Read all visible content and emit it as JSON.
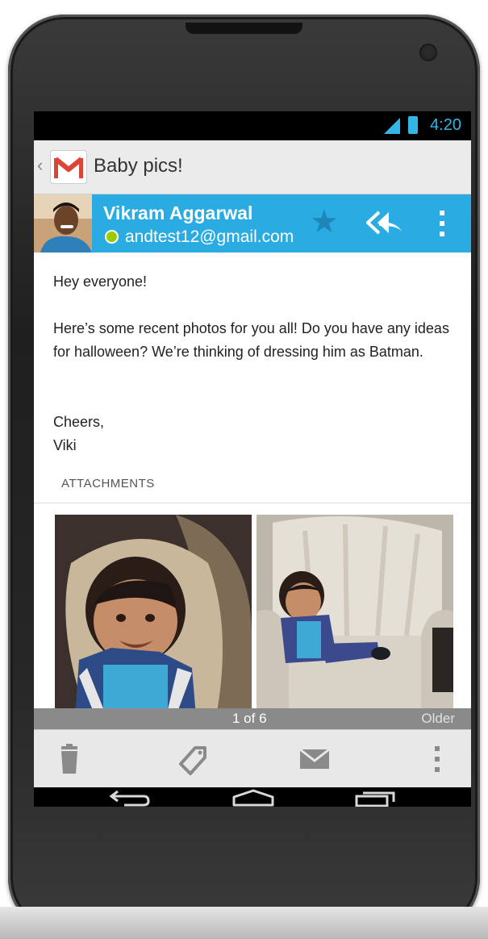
{
  "status": {
    "time": "4:20"
  },
  "actionbar": {
    "subject": "Baby pics!"
  },
  "sender": {
    "name": "Vikram Aggarwal",
    "email": "andtest12@gmail.com"
  },
  "message": {
    "greeting": "Hey everyone!",
    "para1": "Here’s some recent photos for you all! Do you have any ideas for halloween? We’re thinking of dressing him as Batman.",
    "signoff": "Cheers,",
    "signature": "Viki"
  },
  "attachments": {
    "label": "ATTACHMENTS"
  },
  "pager": {
    "count": "1 of 6",
    "older": "Older"
  },
  "icons": {
    "back": "chevron-left-icon",
    "app": "gmail-icon",
    "star": "star-icon",
    "reply_all": "reply-all-icon",
    "overflow": "overflow-menu-icon",
    "delete": "trash-icon",
    "label": "label-tag-icon",
    "mark_unread": "envelope-icon",
    "nav_back": "back-arrow-icon",
    "nav_home": "home-icon",
    "nav_recents": "recents-icon"
  },
  "colors": {
    "accent": "#2aace2",
    "presence": "#99cc00",
    "status_blue": "#33b5e5"
  }
}
